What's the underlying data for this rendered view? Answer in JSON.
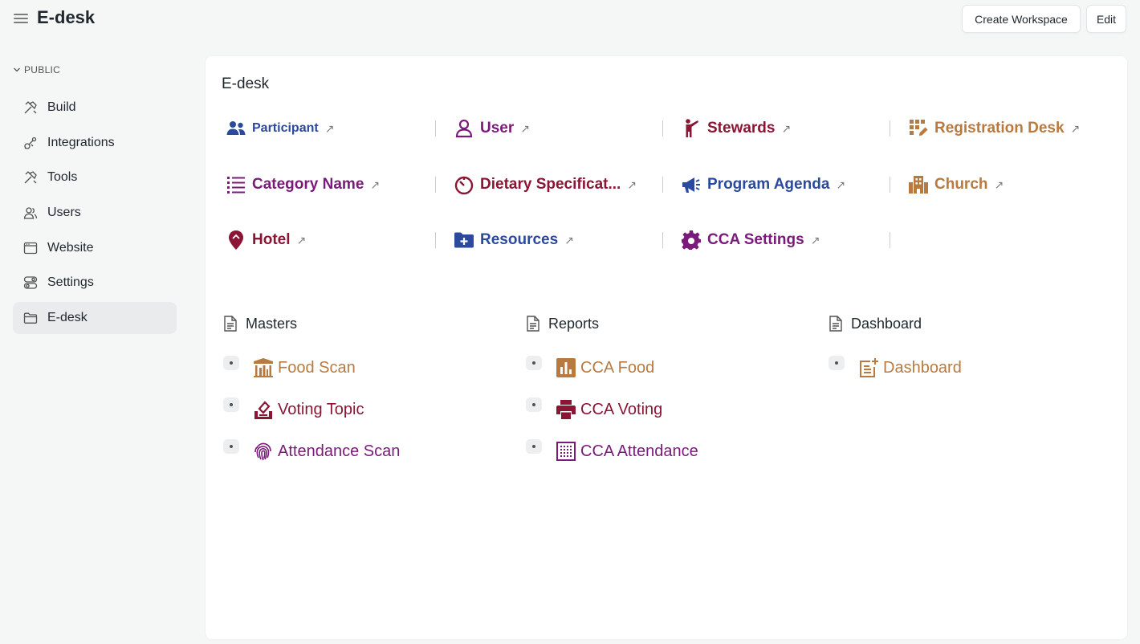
{
  "app": {
    "title": "E-desk"
  },
  "toolbar": {
    "create_workspace_label": "Create Workspace",
    "edit_label": "Edit"
  },
  "sidebar": {
    "section_label": "PUBLIC",
    "items": [
      {
        "label": "Build",
        "icon": "hammer-icon"
      },
      {
        "label": "Integrations",
        "icon": "plug-icon"
      },
      {
        "label": "Tools",
        "icon": "tools-icon"
      },
      {
        "label": "Users",
        "icon": "users-icon"
      },
      {
        "label": "Website",
        "icon": "browser-icon"
      },
      {
        "label": "Settings",
        "icon": "toggles-icon"
      },
      {
        "label": "E-desk",
        "icon": "folder-icon"
      }
    ]
  },
  "main": {
    "title": "E-desk",
    "shortcuts": [
      {
        "label": "Participant",
        "icon": "people-icon",
        "color": "#2b4a9e"
      },
      {
        "label": "User",
        "icon": "user-icon",
        "color": "#7a1a7a"
      },
      {
        "label": "Stewards",
        "icon": "person-pointing-icon",
        "color": "#8b1535"
      },
      {
        "label": "Registration Desk",
        "icon": "grid-pencil-icon",
        "color": "#b97a40"
      },
      {
        "label": "Category Name",
        "icon": "list-icon",
        "color": "#7a1a7a"
      },
      {
        "label": "Dietary Specificat...",
        "icon": "timer-icon",
        "color": "#8b1535"
      },
      {
        "label": "Program Agenda",
        "icon": "megaphone-icon",
        "color": "#2b4a9e"
      },
      {
        "label": "Church",
        "icon": "building-icon",
        "color": "#b97a40"
      },
      {
        "label": "Hotel",
        "icon": "location-pin-icon",
        "color": "#8b1535"
      },
      {
        "label": "Resources",
        "icon": "folder-plus-icon",
        "color": "#2b4a9e"
      },
      {
        "label": "CCA Settings",
        "icon": "gear-icon",
        "color": "#7a1a7a"
      }
    ],
    "cards": [
      {
        "title": "Masters",
        "links": [
          {
            "label": "Food Scan",
            "icon": "food-stall-icon",
            "color": "#b97a40"
          },
          {
            "label": "Voting Topic",
            "icon": "ballot-box-icon",
            "color": "#8b1535"
          },
          {
            "label": "Attendance Scan",
            "icon": "fingerprint-icon",
            "color": "#7a1a7a"
          }
        ]
      },
      {
        "title": "Reports",
        "links": [
          {
            "label": "CCA Food",
            "icon": "bar-chart-icon",
            "color": "#b97a40"
          },
          {
            "label": "CCA Voting",
            "icon": "printer-icon",
            "color": "#8b1535"
          },
          {
            "label": "CCA Attendance",
            "icon": "dotted-grid-icon",
            "color": "#7a1a7a"
          }
        ]
      },
      {
        "title": "Dashboard",
        "links": [
          {
            "label": "Dashboard",
            "icon": "note-plus-icon",
            "color": "#b97a40"
          }
        ]
      }
    ]
  }
}
